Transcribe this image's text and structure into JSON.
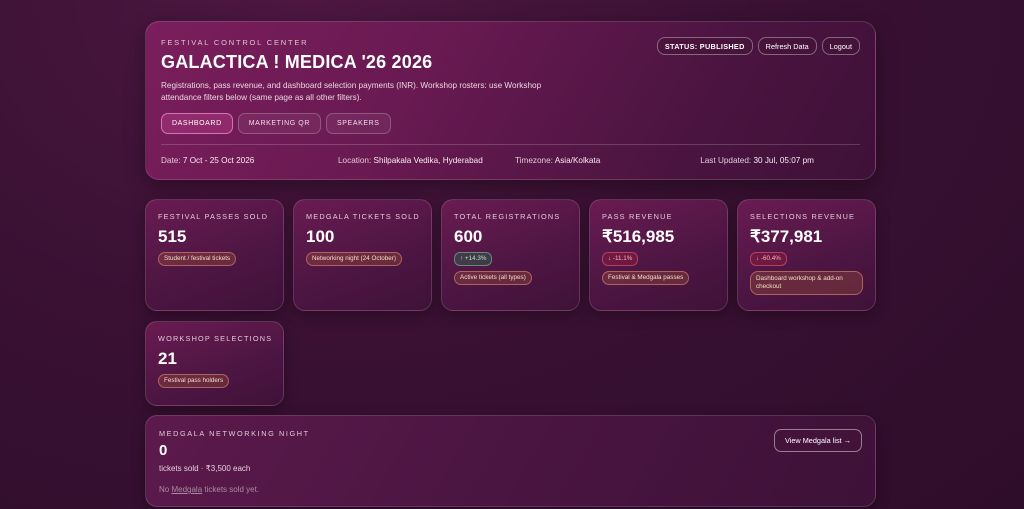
{
  "header": {
    "eyebrow": "FESTIVAL CONTROL CENTER",
    "title": "GALACTICA ! MEDICA '26 2026",
    "description": "Registrations, pass revenue, and dashboard selection payments (INR). Workshop rosters: use Workshop attendance filters below (same page as all other filters).",
    "status_label": "STATUS: PUBLISHED",
    "refresh_label": "Refresh Data",
    "logout_label": "Logout"
  },
  "nav": {
    "tabs": [
      {
        "label": "DASHBOARD",
        "active": true
      },
      {
        "label": "MARKETING QR",
        "active": false
      },
      {
        "label": "SPEAKERS",
        "active": false
      }
    ]
  },
  "meta": {
    "date_label": "Date:",
    "date_value": "7 Oct - 25 Oct 2026",
    "location_label": "Location:",
    "location_value": "Shilpakala Vedika, Hyderabad",
    "timezone_label": "Timezone:",
    "timezone_value": "Asia/Kolkata",
    "updated_label": "Last Updated:",
    "updated_value": "30 Jul, 05:07 pm"
  },
  "stats": [
    {
      "label": "FESTIVAL PASSES SOLD",
      "value": "515",
      "tag": "Student / festival tickets"
    },
    {
      "label": "MEDGALA TICKETS SOLD",
      "value": "100",
      "tag": "Networking night (24 October)"
    },
    {
      "label": "TOTAL REGISTRATIONS",
      "value": "600",
      "delta": "+14.3%",
      "tag": "Active tickets (all types)"
    },
    {
      "label": "PASS REVENUE",
      "value": "₹516,985",
      "delta": "-11.1%",
      "tag": "Festival & Medgala passes"
    },
    {
      "label": "SELECTIONS REVENUE",
      "value": "₹377,981",
      "delta": "-60.4%",
      "tag": "Dashboard workshop & add-on checkout"
    },
    {
      "label": "WORKSHOP SELECTIONS",
      "value": "21",
      "tag": "Festival pass holders"
    }
  ],
  "medgala": {
    "label": "MEDGALA NETWORKING NIGHT",
    "value": "0",
    "sub": "tickets sold · ₹3,500 each",
    "empty_prefix": "No ",
    "empty_link": "Medgala",
    "empty_suffix": " tickets sold yet.",
    "view_button": "View Medgala list →"
  }
}
